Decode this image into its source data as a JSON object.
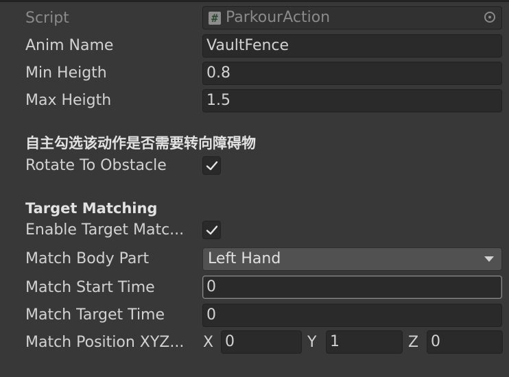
{
  "script_row": {
    "label": "Script",
    "value": "ParkourAction"
  },
  "fields": {
    "anim_name": {
      "label": "Anim Name",
      "value": "VaultFence"
    },
    "min_height": {
      "label": "Min Heigth",
      "value": "0.8"
    },
    "max_height": {
      "label": "Max Heigth",
      "value": "1.5"
    }
  },
  "rotate_section": {
    "header": "自主勾选该动作是否需要转向障碍物",
    "rotate_label": "Rotate To Obstacle",
    "rotate_checked": true
  },
  "target_matching": {
    "header": "Target Matching",
    "enable_label": "Enable Target Matc...",
    "enable_checked": true,
    "body_part_label": "Match Body Part",
    "body_part_value": "Left Hand",
    "start_time_label": "Match Start Time",
    "start_time_value": "0",
    "target_time_label": "Match Target Time",
    "target_time_value": "0",
    "position_label": "Match Position XYZ...",
    "position": {
      "x_label": "X",
      "x_value": "0",
      "y_label": "Y",
      "y_value": "1",
      "z_label": "Z",
      "z_value": "0"
    }
  },
  "colors": {
    "background": "#383838",
    "field_background": "#2a2a2a",
    "dropdown_background": "#515151",
    "text": "#d2d2d2",
    "disabled_text": "#8a8a8a"
  }
}
